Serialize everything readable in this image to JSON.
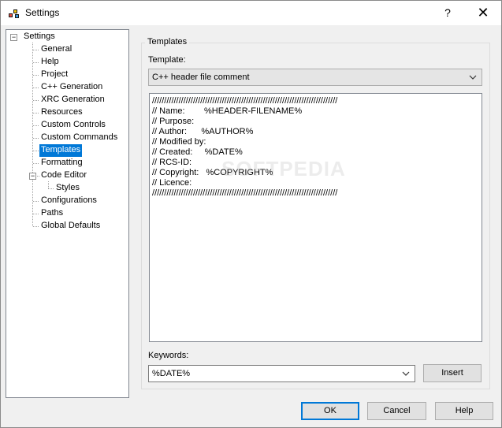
{
  "window": {
    "title": "Settings",
    "help_glyph": "?",
    "close_glyph": "✕"
  },
  "tree": {
    "root": "Settings",
    "items": [
      {
        "label": "General"
      },
      {
        "label": "Help"
      },
      {
        "label": "Project"
      },
      {
        "label": "C++ Generation"
      },
      {
        "label": "XRC Generation"
      },
      {
        "label": "Resources"
      },
      {
        "label": "Custom Controls"
      },
      {
        "label": "Custom Commands"
      },
      {
        "label": "Templates",
        "selected": true
      },
      {
        "label": "Formatting"
      },
      {
        "label": "Code Editor",
        "expanded": true,
        "children": [
          "Styles"
        ]
      },
      {
        "label": "Configurations"
      },
      {
        "label": "Paths"
      },
      {
        "label": "Global Defaults"
      }
    ]
  },
  "panel": {
    "group_title": "Templates",
    "template_label": "Template:",
    "template_value": "C++ header file comment",
    "editor_lines": [
      "/////////////////////////////////////////////////////////////////////////////",
      "// Name:        %HEADER-FILENAME%",
      "// Purpose:",
      "// Author:      %AUTHOR%",
      "// Modified by:",
      "// Created:     %DATE%",
      "// RCS-ID:",
      "// Copyright:   %COPYRIGHT%",
      "// Licence:",
      "/////////////////////////////////////////////////////////////////////////////"
    ],
    "keywords_label": "Keywords:",
    "keywords_value": "%DATE%",
    "insert_button": "Insert"
  },
  "footer": {
    "ok": "OK",
    "cancel": "Cancel",
    "help": "Help"
  },
  "watermark": "SOFTPEDIA",
  "colors": {
    "selection": "#0078d7",
    "default_button_border": "#0078d7"
  }
}
